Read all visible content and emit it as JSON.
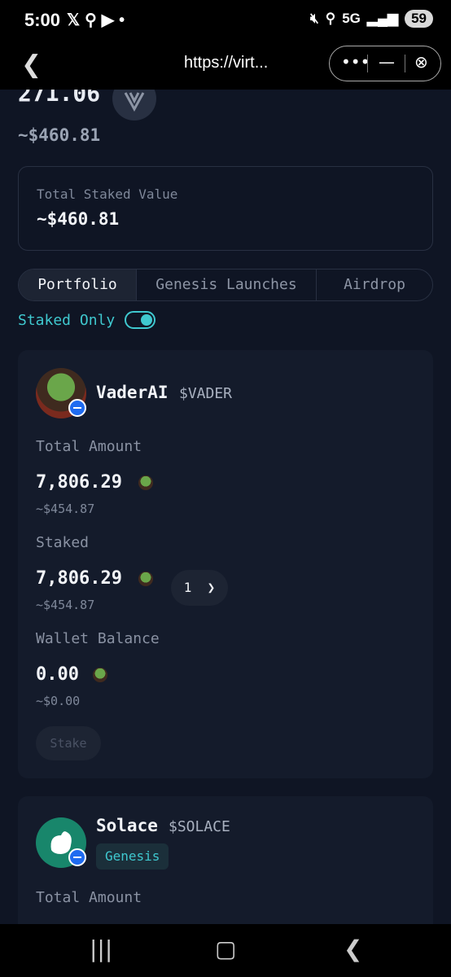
{
  "status_bar": {
    "time": "5:00",
    "left_icons": [
      "x-logo-icon",
      "location-pin-icon",
      "youtube-icon",
      "dot-icon"
    ],
    "network": "5G",
    "battery": "59"
  },
  "browser": {
    "url": "https://virt...",
    "more_label": "•••",
    "minimize_label": "—",
    "close_label": "⊗"
  },
  "balance": {
    "amount": "271.06",
    "usd": "~$460.81"
  },
  "staked_summary": {
    "label": "Total Staked Value",
    "value": "~$460.81"
  },
  "tabs": [
    {
      "label": "Portfolio",
      "active": true
    },
    {
      "label": "Genesis Launches",
      "active": false
    },
    {
      "label": "Airdrop",
      "active": false
    }
  ],
  "filter": {
    "label": "Staked Only",
    "enabled": true
  },
  "tokens": [
    {
      "name": "VaderAI",
      "ticker": "$VADER",
      "total_amount_label": "Total Amount",
      "total_amount": "7,806.29",
      "total_usd": "~$454.87",
      "staked_label": "Staked",
      "staked": "7,806.29",
      "staked_usd": "~$454.87",
      "stake_count": "1",
      "wallet_label": "Wallet Balance",
      "wallet": "0.00",
      "wallet_usd": "~$0.00",
      "stake_button": "Stake"
    },
    {
      "name": "Solace",
      "ticker": "$SOLACE",
      "badge": "Genesis",
      "total_amount_label": "Total Amount"
    }
  ],
  "colors": {
    "background": "#0f1524",
    "card": "#141b2b",
    "accent": "#3fc8cf",
    "badge_blue": "#1f6bf0"
  }
}
